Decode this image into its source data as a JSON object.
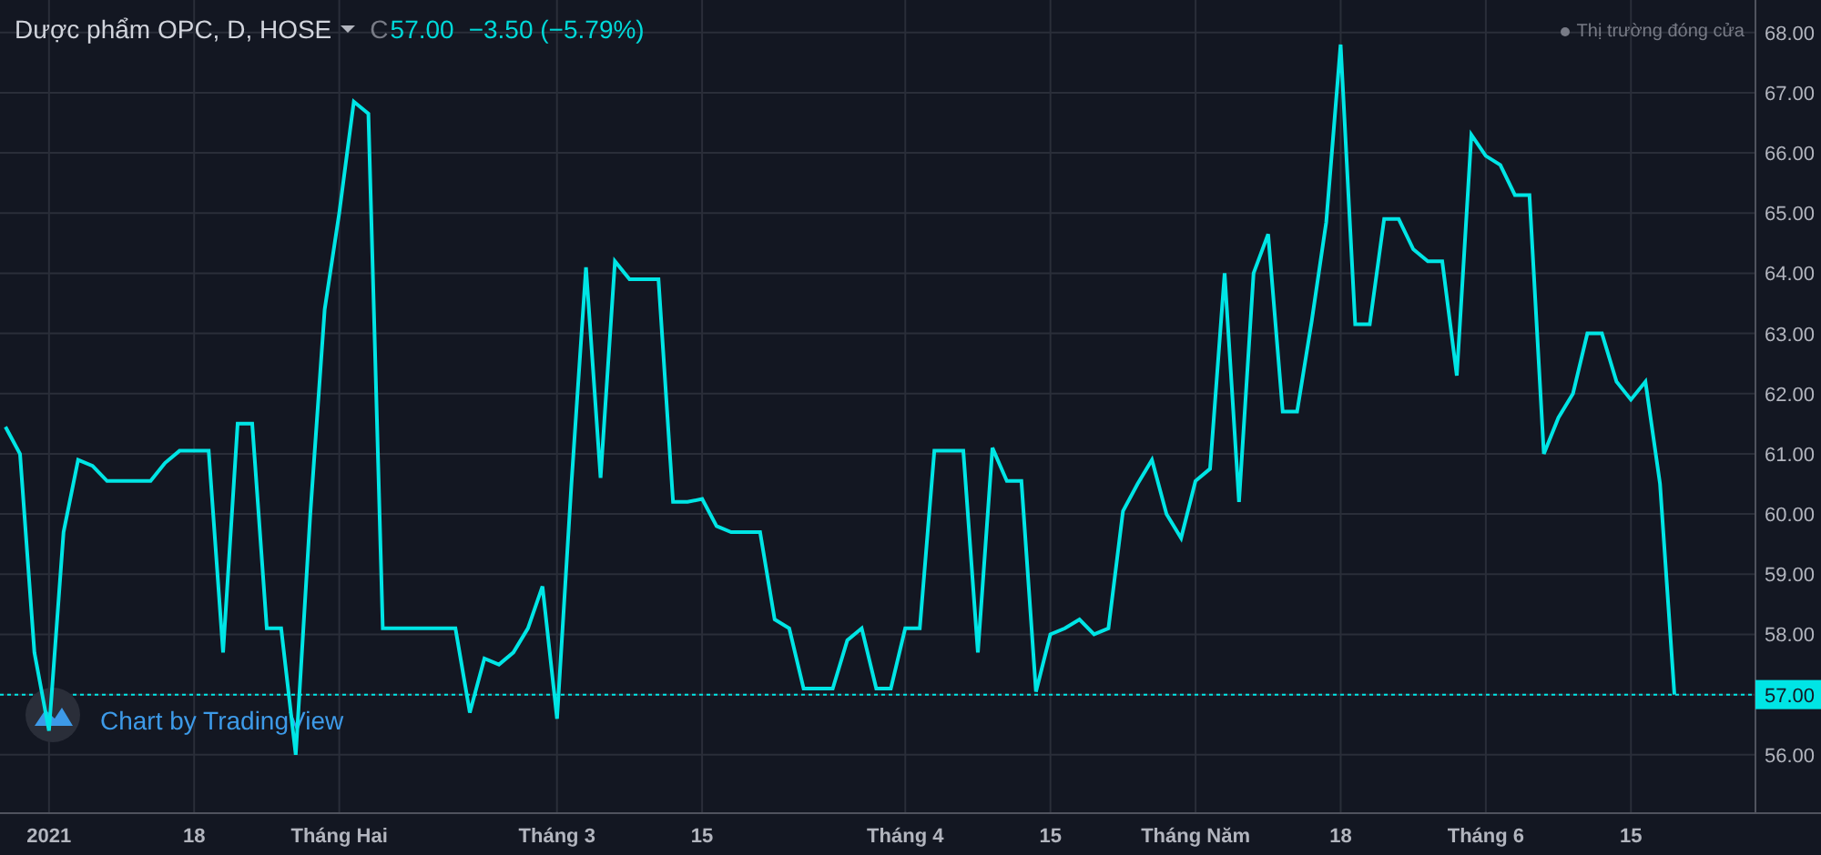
{
  "header": {
    "symbol": "Dược phẩm OPC, D, HOSE",
    "close_prefix": "C",
    "close": "57.00",
    "change": "−3.50 (−5.79%)"
  },
  "market_status": "Thị trường đóng cửa",
  "branding": "Chart by TradingView",
  "chart_data": {
    "type": "line",
    "grid": true,
    "ylim": [
      55.03,
      68.54
    ],
    "yticks": [
      {
        "value": 56,
        "label": "56.00"
      },
      {
        "value": 57,
        "label": "57.00"
      },
      {
        "value": 58,
        "label": "58.00"
      },
      {
        "value": 59,
        "label": "59.00"
      },
      {
        "value": 60,
        "label": "60.00"
      },
      {
        "value": 61,
        "label": "61.00"
      },
      {
        "value": 62,
        "label": "62.00"
      },
      {
        "value": 63,
        "label": "63.00"
      },
      {
        "value": 64,
        "label": "64.00"
      },
      {
        "value": 65,
        "label": "65.00"
      },
      {
        "value": 66,
        "label": "66.00"
      },
      {
        "value": 67,
        "label": "67.00"
      },
      {
        "value": 68,
        "label": "68.00"
      }
    ],
    "categories": [
      null,
      null,
      null,
      "2021",
      null,
      null,
      null,
      null,
      null,
      null,
      null,
      null,
      null,
      "18",
      null,
      null,
      null,
      null,
      null,
      null,
      null,
      null,
      null,
      "Tháng Hai",
      null,
      null,
      null,
      null,
      null,
      null,
      null,
      null,
      null,
      null,
      null,
      null,
      null,
      null,
      "Tháng 3",
      null,
      null,
      null,
      null,
      null,
      null,
      null,
      null,
      null,
      "15",
      null,
      null,
      null,
      null,
      null,
      null,
      null,
      null,
      null,
      null,
      null,
      null,
      null,
      "Tháng 4",
      null,
      null,
      null,
      null,
      null,
      null,
      null,
      null,
      null,
      "15",
      null,
      null,
      null,
      null,
      null,
      null,
      null,
      null,
      null,
      "Tháng Năm",
      null,
      null,
      null,
      null,
      null,
      null,
      null,
      null,
      null,
      "18",
      null,
      null,
      null,
      null,
      null,
      null,
      null,
      null,
      null,
      "Tháng 6",
      null,
      null,
      null,
      null,
      null,
      null,
      null,
      null,
      null,
      "15",
      null,
      null,
      null
    ],
    "ref_lines": [
      {
        "axis": "y",
        "value": 57.0,
        "color": "#00e5e5"
      }
    ],
    "series": [
      {
        "color": "#00e5e5",
        "values": [
          61.45,
          61.0,
          57.7,
          56.4,
          59.7,
          60.9,
          60.8,
          60.55,
          60.55,
          60.55,
          60.55,
          60.85,
          61.05,
          61.05,
          61.05,
          57.7,
          61.5,
          61.5,
          58.1,
          58.1,
          56.0,
          60.0,
          63.4,
          65.0,
          66.85,
          66.65,
          58.1,
          58.1,
          58.1,
          58.1,
          58.1,
          58.1,
          56.7,
          57.6,
          57.5,
          57.7,
          58.1,
          58.8,
          56.6,
          60.5,
          64.1,
          60.6,
          64.2,
          63.9,
          63.9,
          63.9,
          60.2,
          60.2,
          60.25,
          59.8,
          59.7,
          59.7,
          59.7,
          58.25,
          58.1,
          57.1,
          57.1,
          57.1,
          57.9,
          58.1,
          57.1,
          57.1,
          58.1,
          58.1,
          61.05,
          61.05,
          61.05,
          57.7,
          61.1,
          60.55,
          60.55,
          57.05,
          58.0,
          58.1,
          58.25,
          58.0,
          58.1,
          60.05,
          60.5,
          60.9,
          60.0,
          59.6,
          60.55,
          60.75,
          64.0,
          60.2,
          64.0,
          64.65,
          61.7,
          61.7,
          63.2,
          64.85,
          67.8,
          63.15,
          63.15,
          64.9,
          64.9,
          64.4,
          64.2,
          64.2,
          62.3,
          66.3,
          65.95,
          65.8,
          65.3,
          65.3,
          61.0,
          61.6,
          62.0,
          63.0,
          63.0,
          62.2,
          61.9,
          62.2,
          60.5,
          57.0
        ]
      }
    ]
  }
}
